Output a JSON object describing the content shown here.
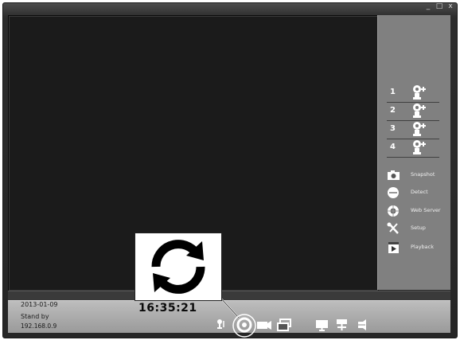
{
  "window": {
    "controls": [
      "_",
      "□",
      "x"
    ]
  },
  "channels": [
    {
      "number": "1",
      "icon": "camera-plus-icon"
    },
    {
      "number": "2",
      "icon": "camera-plus-icon"
    },
    {
      "number": "3",
      "icon": "camera-plus-icon"
    },
    {
      "number": "4",
      "icon": "camera-plus-icon"
    }
  ],
  "functions": [
    {
      "label": "Snapshot",
      "icon": "snapshot-icon"
    },
    {
      "label": "Detect",
      "icon": "detect-icon"
    },
    {
      "label": "Web Server",
      "icon": "web-server-icon"
    },
    {
      "label": "Setup",
      "icon": "setup-icon"
    },
    {
      "label": "Playback",
      "icon": "playback-icon"
    }
  ],
  "status": {
    "date": "2013-01-09",
    "time": "16:35:21",
    "state": "Stand by",
    "ip": "192.168.0.9"
  },
  "toolbar": {
    "items": [
      "talk-icon",
      "refresh-icon",
      "record-icon",
      "multi-view-icon",
      "monitor-icon",
      "network-icon",
      "audio-icon"
    ]
  },
  "callout": {
    "icon": "refresh-icon"
  },
  "colors": {
    "panel": "#808080",
    "video": "#1b1b1b",
    "bottom_bar": "#b0b0b0"
  }
}
